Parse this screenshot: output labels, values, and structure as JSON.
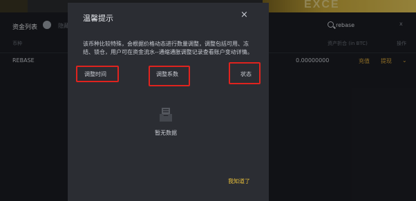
{
  "banner": {
    "text": "EXCE"
  },
  "page": {
    "section_title": "资金列表",
    "toggle_label": "隐藏",
    "search": {
      "value": "rebase",
      "clear": "x"
    },
    "columns": {
      "coin": "币种",
      "valuation": "资产折合 (in BTC)",
      "ops": "操作"
    },
    "rows": [
      {
        "coin": "REBASE",
        "value": "0.00000000",
        "deposit": "充值",
        "withdraw": "提现",
        "more": "⌄"
      }
    ]
  },
  "modal": {
    "title": "温馨提示",
    "close": "×",
    "description": "该币种比较特殊，会根据价格动态进行数量调整，调整包括可用、冻结、锁仓，用户可在资金流水--通缩通胀调整记录查看账户变动详情。",
    "table_headers": {
      "time": "调整时间",
      "factor": "调整系数",
      "status": "状态"
    },
    "empty_text": "暂无数据",
    "confirm": "我知道了"
  }
}
